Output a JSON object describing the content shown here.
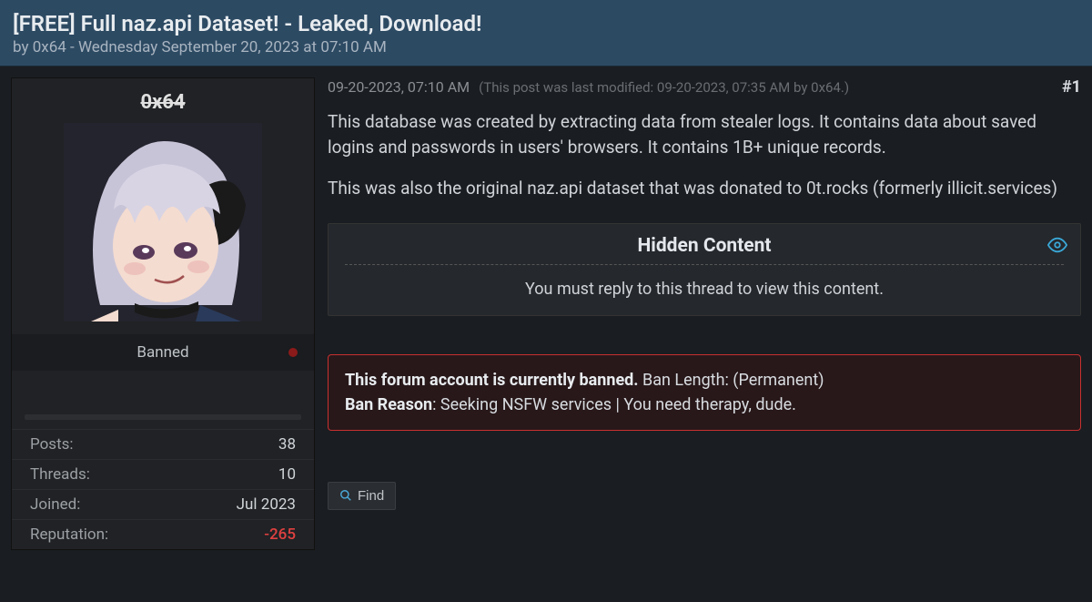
{
  "header": {
    "title": "[FREE] Full naz.api Dataset! - Leaked, Download!",
    "byline": "by 0x64 - Wednesday September 20, 2023 at 07:10 AM"
  },
  "author": {
    "username": "0x64",
    "status": "Banned",
    "stats": {
      "posts_label": "Posts:",
      "posts_value": "38",
      "threads_label": "Threads:",
      "threads_value": "10",
      "joined_label": "Joined:",
      "joined_value": "Jul 2023",
      "rep_label": "Reputation:",
      "rep_value": "-265"
    }
  },
  "post": {
    "timestamp": "09-20-2023, 07:10 AM",
    "edited": "(This post was last modified: 09-20-2023, 07:35 AM by 0x64.)",
    "number": "#1",
    "para1": "This database was created by extracting data from stealer logs. It contains data about saved logins and passwords in users' browsers. It contains 1B+ unique records.",
    "para2": "This was also the original naz.api dataset that was donated to 0t.rocks (formerly illicit.services)"
  },
  "hidden": {
    "title": "Hidden Content",
    "message": "You must reply to this thread to view this content."
  },
  "ban": {
    "line1_bold": "This forum account is currently banned.",
    "line1_rest": " Ban Length: (Permanent)",
    "line2_bold": "Ban Reason",
    "line2_rest": ": Seeking NSFW services | You need therapy, dude."
  },
  "actions": {
    "find": "Find"
  }
}
